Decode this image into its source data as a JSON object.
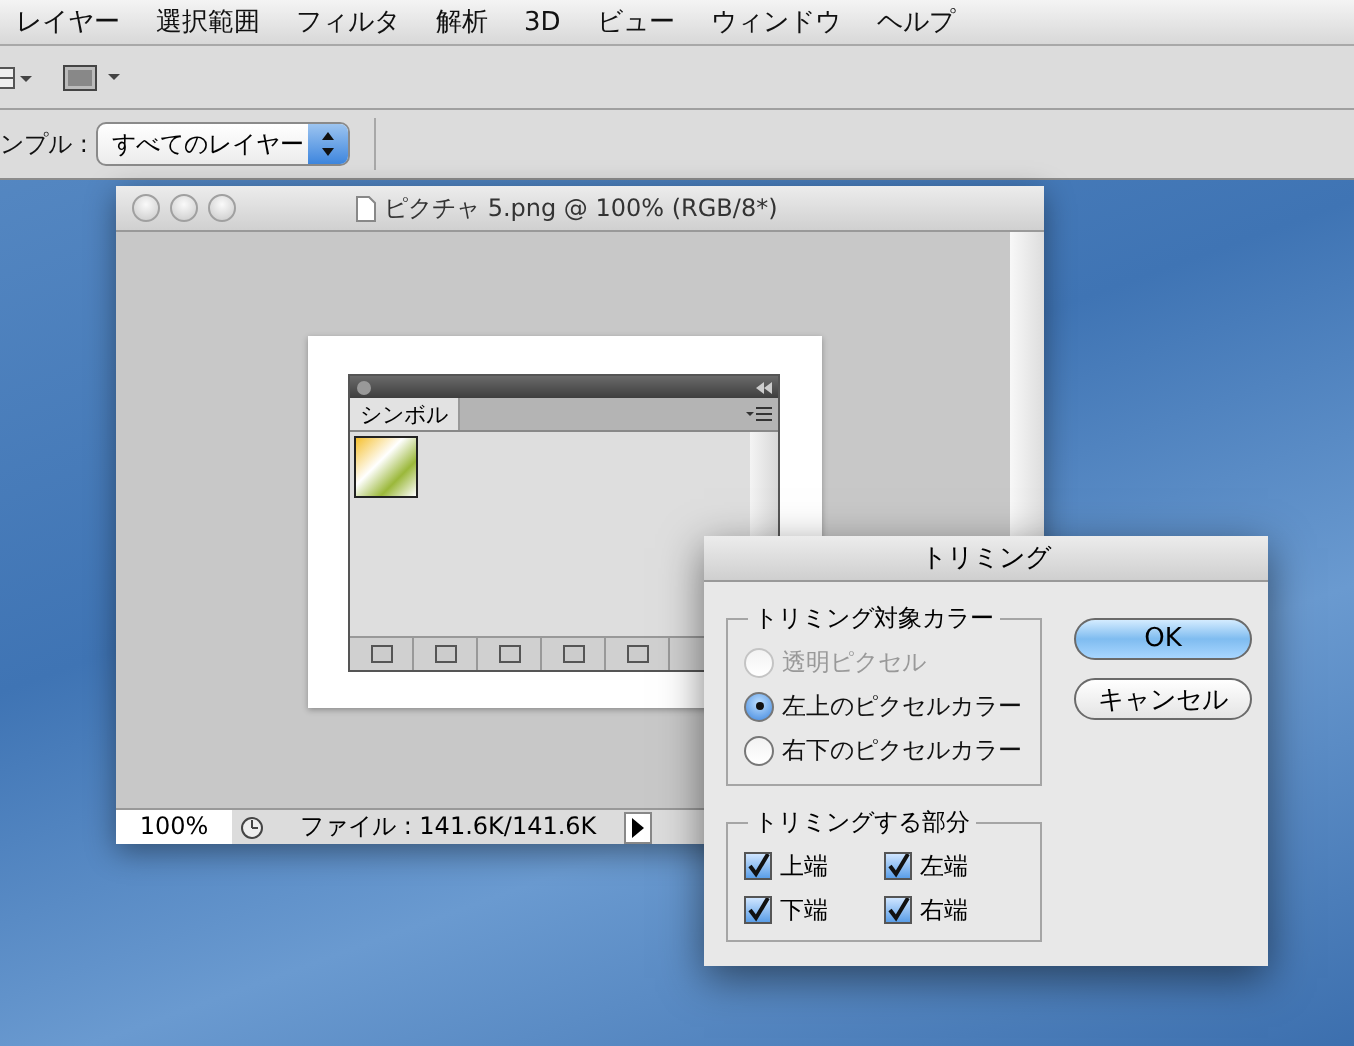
{
  "menu_bar": {
    "items": [
      "レイヤー",
      "選択範囲",
      "フィルタ",
      "解析",
      "3D",
      "ビュー",
      "ウィンドウ",
      "ヘルプ"
    ]
  },
  "options_bar": {
    "label": "ンプル :",
    "select_value": "すべてのレイヤー"
  },
  "document_window": {
    "title": "ピクチャ 5.png @ 100% (RGB/8*)",
    "zoom": "100%",
    "status": "ファイル : 141.6K/141.6K"
  },
  "symbols_panel": {
    "tab": "シンボル"
  },
  "dialog": {
    "title": "トリミング",
    "color_group": {
      "title": "トリミング対象カラー",
      "options": [
        {
          "label": "透明ピクセル",
          "selected": false,
          "disabled": true
        },
        {
          "label": "左上のピクセルカラー",
          "selected": true,
          "disabled": false
        },
        {
          "label": "右下のピクセルカラー",
          "selected": false,
          "disabled": false
        }
      ]
    },
    "parts_group": {
      "title": "トリミングする部分",
      "options": [
        {
          "label": "上端",
          "checked": true
        },
        {
          "label": "左端",
          "checked": true
        },
        {
          "label": "下端",
          "checked": true
        },
        {
          "label": "右端",
          "checked": true
        }
      ]
    },
    "buttons": [
      {
        "label": "OK",
        "kind": "default"
      },
      {
        "label": "キャンセル",
        "kind": "normal"
      }
    ]
  }
}
